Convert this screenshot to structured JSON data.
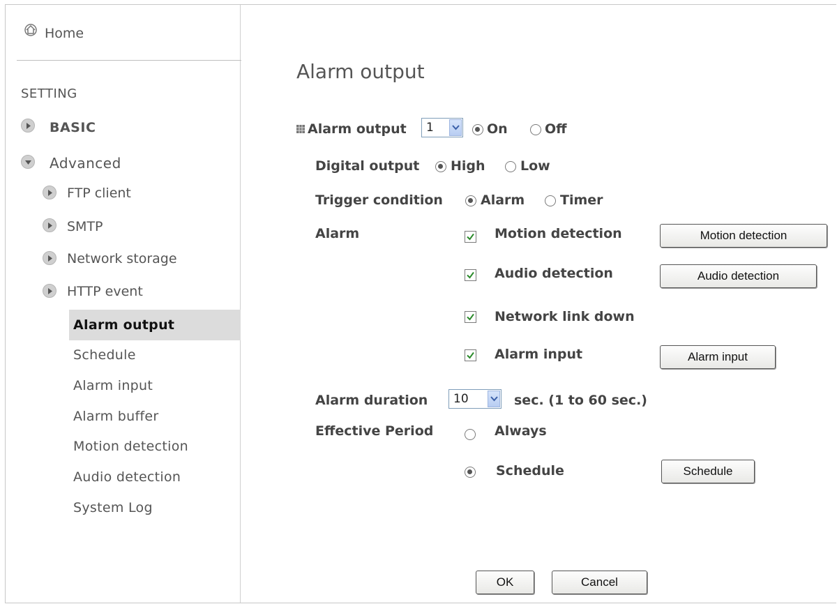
{
  "sidebar": {
    "home": "Home",
    "section": "SETTING",
    "basic": "BASIC",
    "advanced": "Advanced",
    "advanced_items": [
      "FTP client",
      "SMTP",
      "Network storage",
      "HTTP event"
    ],
    "sub_items": [
      "Alarm output",
      "Schedule",
      "Alarm input",
      "Alarm buffer",
      "Motion detection",
      "Audio detection",
      "System Log"
    ],
    "active_item": "Alarm output"
  },
  "main": {
    "title": "Alarm output",
    "alarm_output": {
      "label": "Alarm output",
      "selected": "1",
      "on_label": "On",
      "off_label": "Off",
      "value": "On"
    },
    "digital_output": {
      "label": "Digital output",
      "high_label": "High",
      "low_label": "Low",
      "value": "High"
    },
    "trigger_condition": {
      "label": "Trigger condition",
      "alarm_label": "Alarm",
      "timer_label": "Timer",
      "value": "Alarm"
    },
    "alarm": {
      "label": "Alarm",
      "items": [
        {
          "label": "Motion detection",
          "checked": true,
          "button": "Motion detection"
        },
        {
          "label": "Audio detection",
          "checked": true,
          "button": "Audio detection"
        },
        {
          "label": "Network link down",
          "checked": true,
          "button": ""
        },
        {
          "label": "Alarm input",
          "checked": true,
          "button": "Alarm input"
        }
      ]
    },
    "alarm_duration": {
      "label": "Alarm duration",
      "selected": "10",
      "hint": "sec. (1 to 60 sec.)"
    },
    "effective_period": {
      "label": "Effective Period",
      "always_label": "Always",
      "schedule_label": "Schedule",
      "value": "Schedule",
      "schedule_button": "Schedule"
    },
    "ok_button": "OK",
    "cancel_button": "Cancel"
  }
}
